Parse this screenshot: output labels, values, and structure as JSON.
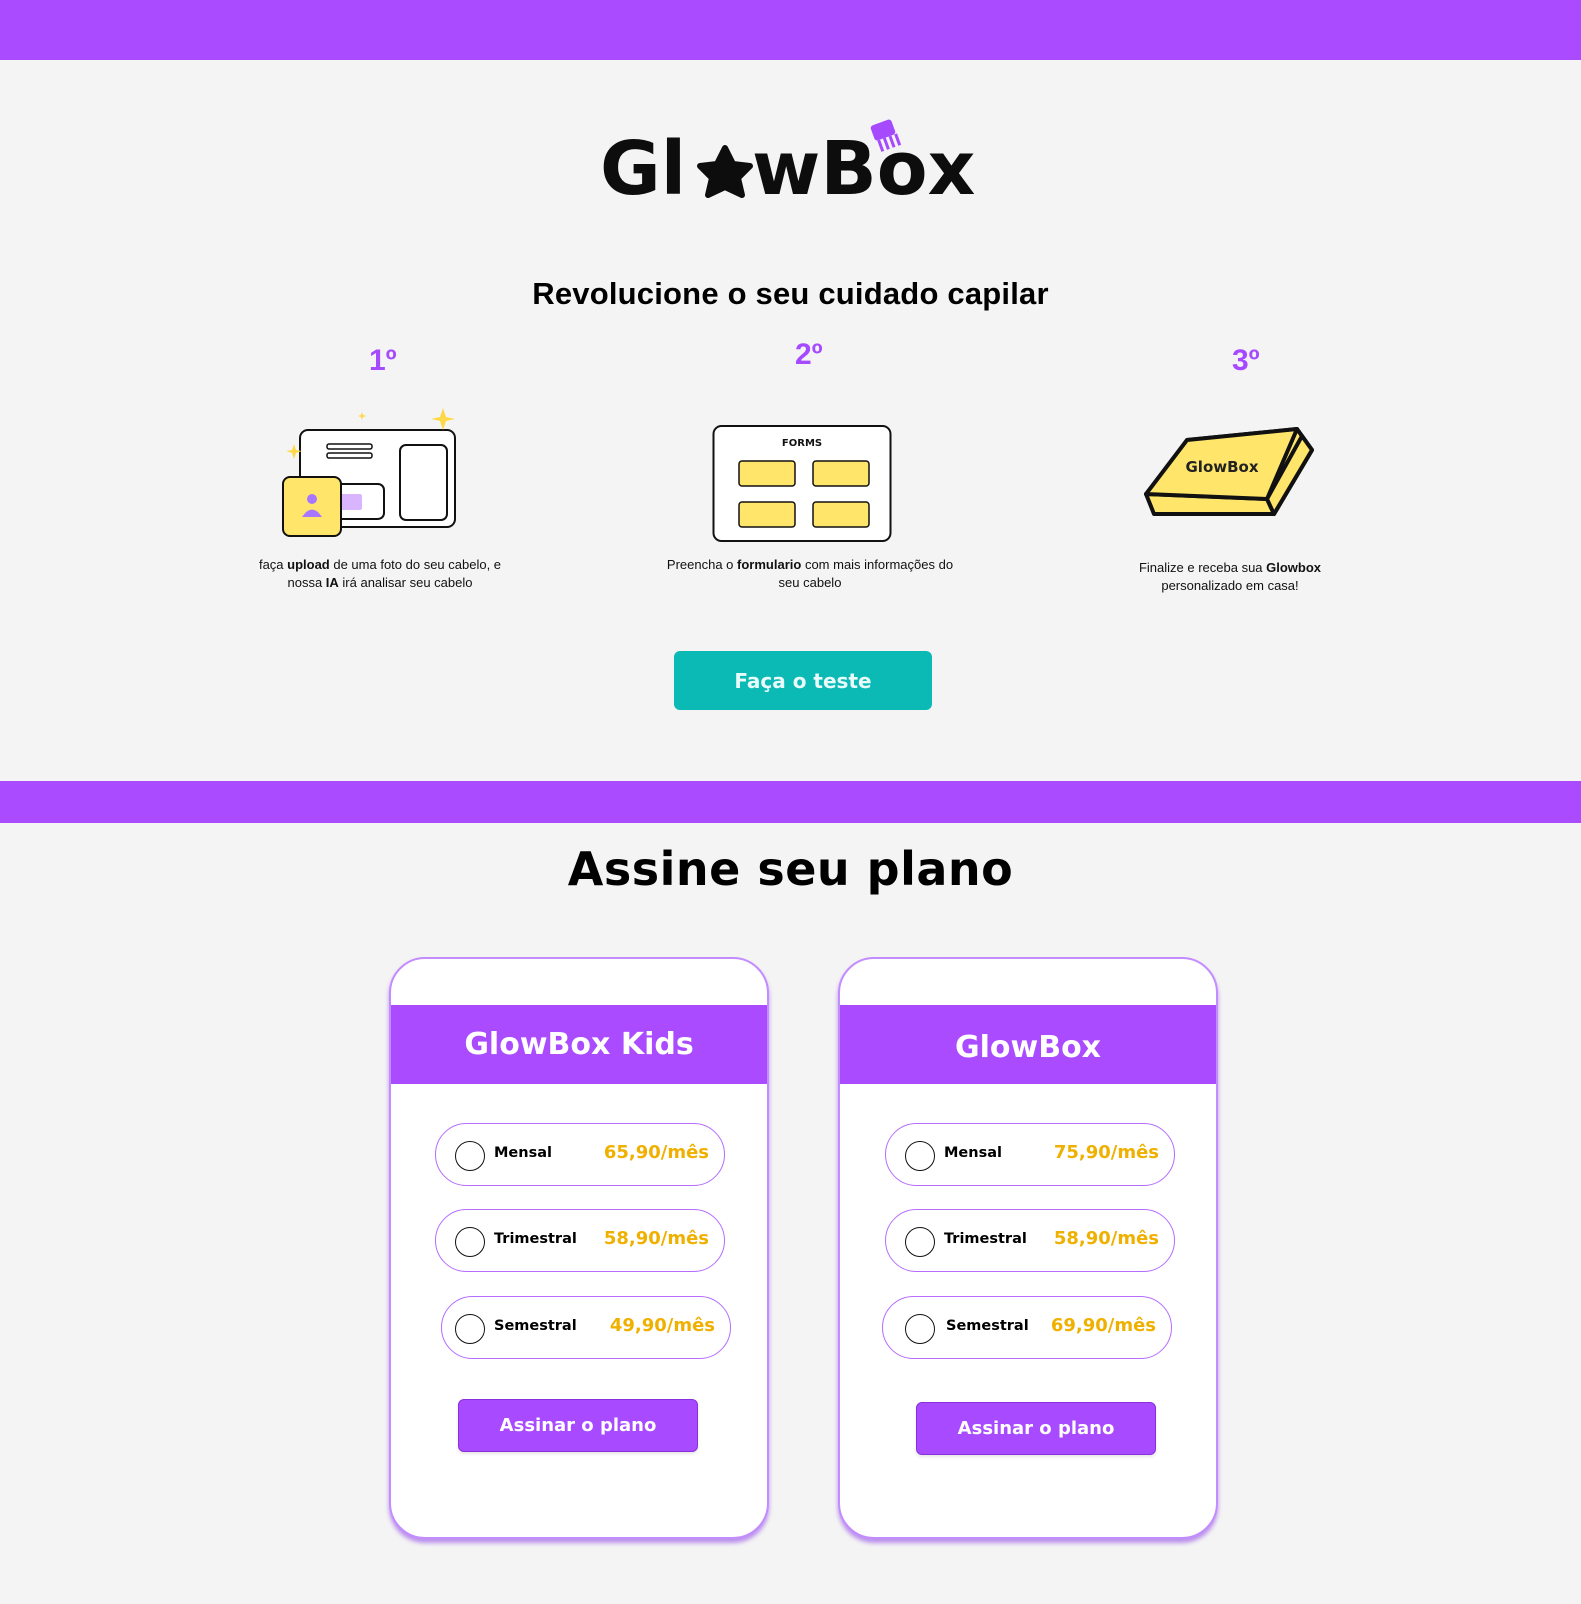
{
  "brand": {
    "logo_text": "GlowBox",
    "accent_color": "#ab4bff",
    "cta_color": "#0bbab4",
    "price_color": "#efb000"
  },
  "hero": {
    "title": "Revolucione o seu cuidado capilar",
    "steps": [
      {
        "number": "1º",
        "icon": "upload-photo-illustration",
        "text_pre": "faça ",
        "text_bold1": "upload",
        "text_mid": " de uma foto do seu cabelo, e nossa ",
        "text_bold2": "IA",
        "text_post": " irá analisar seu cabelo"
      },
      {
        "number": "2º",
        "icon": "form-illustration",
        "form_label": "FORMS",
        "text_pre": "Preencha o ",
        "text_bold1": "formulario",
        "text_post": " com mais informações do seu cabelo"
      },
      {
        "number": "3º",
        "icon": "glowbox-package-illustration",
        "box_label": "GlowBox",
        "text_pre": "Finalize e receba sua ",
        "text_bold1": "Glowbox",
        "text_post": " personalizado em casa!"
      }
    ],
    "cta_label": "Faça o teste"
  },
  "plans": {
    "title": "Assine seu plano",
    "cards": [
      {
        "name": "GlowBox Kids",
        "options": [
          {
            "label": "Mensal",
            "price": "65,90/mês"
          },
          {
            "label": "Trimestral",
            "price": "58,90/mês"
          },
          {
            "label": "Semestral",
            "price": "49,90/mês"
          }
        ],
        "button_label": "Assinar o plano"
      },
      {
        "name": "GlowBox",
        "options": [
          {
            "label": "Mensal",
            "price": "75,90/mês"
          },
          {
            "label": "Trimestral",
            "price": "58,90/mês"
          },
          {
            "label": "Semestral",
            "price": "69,90/mês"
          }
        ],
        "button_label": "Assinar o plano"
      }
    ]
  }
}
